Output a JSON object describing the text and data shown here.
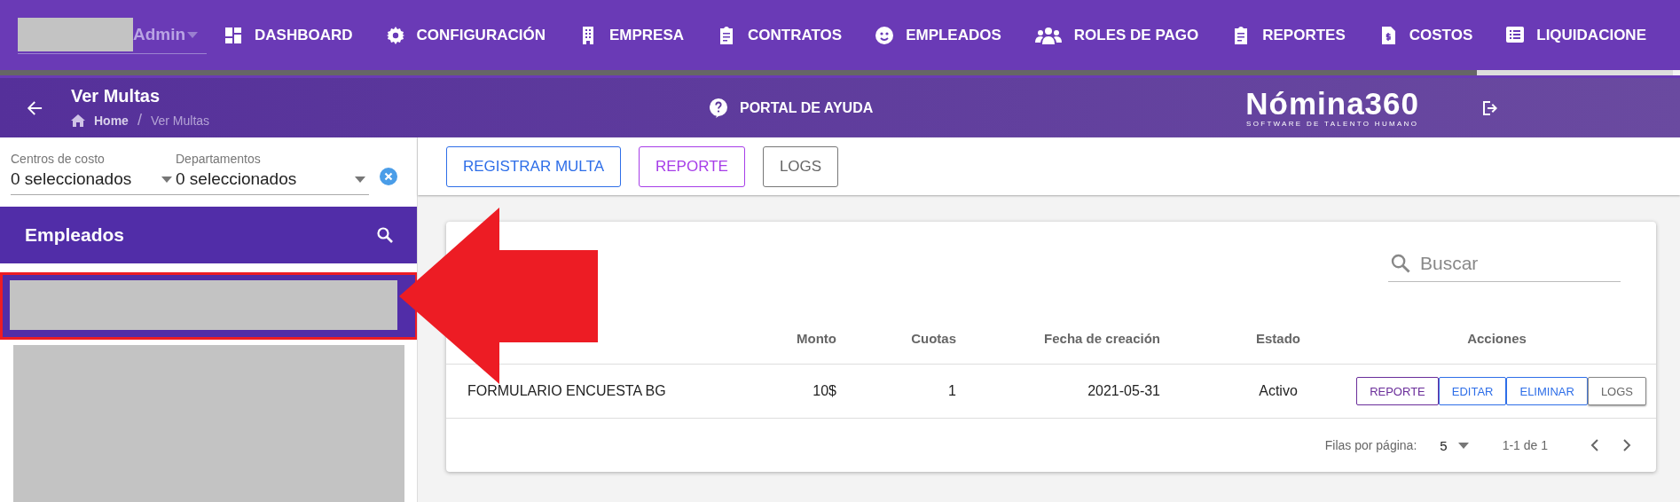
{
  "user_menu": {
    "label": "Admin"
  },
  "nav": [
    {
      "label": "DASHBOARD"
    },
    {
      "label": "CONFIGURACIÓN"
    },
    {
      "label": "EMPRESA"
    },
    {
      "label": "CONTRATOS"
    },
    {
      "label": "EMPLEADOS"
    },
    {
      "label": "ROLES DE PAGO"
    },
    {
      "label": "REPORTES"
    },
    {
      "label": "COSTOS"
    },
    {
      "label": "LIQUIDACIONE"
    }
  ],
  "header": {
    "title": "Ver Multas",
    "breadcrumbs": [
      "Home",
      "Ver Multas"
    ],
    "breadcrumb_separator": "/",
    "help": "PORTAL DE AYUDA",
    "logo": "Nómina360",
    "logo_tagline": "SOFTWARE DE TALENTO HUMANO"
  },
  "filters": [
    {
      "label": "Centros de costo",
      "value": "0 seleccionados"
    },
    {
      "label": "Departamentos",
      "value": "0 seleccionados"
    }
  ],
  "employees": {
    "title": "Empleados",
    "items": [
      {
        "selected": true
      },
      {
        "selected": false
      }
    ]
  },
  "toolbar": [
    "REGISTRAR MULTA",
    "REPORTE",
    "LOGS"
  ],
  "search": {
    "placeholder": "Buscar"
  },
  "table": {
    "columns": [
      "",
      "Monto",
      "Cuotas",
      "Fecha de creación",
      "Estado",
      "Acciones"
    ],
    "rows": [
      {
        "cells": [
          "FORMULARIO ENCUESTA BG",
          "10$",
          "1",
          "2021-05-31",
          "Activo"
        ],
        "actions": [
          "REPORTE",
          "EDITAR",
          "ELIMINAR",
          "LOGS"
        ]
      }
    ]
  },
  "pagination": {
    "rows_label": "Filas por página:",
    "rows_value": "5",
    "range": "1-1 de 1"
  }
}
